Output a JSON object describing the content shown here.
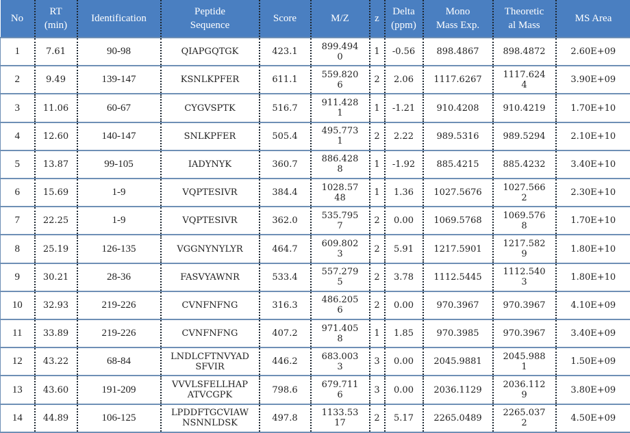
{
  "header_color": "#4a7fc1",
  "columns": [
    "No",
    "RT\n(min)",
    "Identification",
    "Peptide\nSequence",
    "Score",
    "M/Z",
    "z",
    "Delta\n(ppm)",
    "Mono\nMass Exp.",
    "Theoretic\nal Mass",
    "MS Area"
  ],
  "rows": [
    [
      "1",
      "7.61",
      "90-98",
      "QIAPGQTGK",
      "423.1",
      "899.494\n0",
      "1",
      "-0.56",
      "898.4867",
      "898.4872",
      "2.60E+09"
    ],
    [
      "2",
      "9.49",
      "139-147",
      "KSNLKPFER",
      "611.1",
      "559.820\n6",
      "2",
      "2.06",
      "1117.6267",
      "1117.624\n4",
      "3.90E+09"
    ],
    [
      "3",
      "11.06",
      "60-67",
      "CYGVSPTK",
      "516.7",
      "911.428\n1",
      "1",
      "-1.21",
      "910.4208",
      "910.4219",
      "1.70E+10"
    ],
    [
      "4",
      "12.60",
      "140-147",
      "SNLKPFER",
      "505.4",
      "495.773\n1",
      "2",
      "2.22",
      "989.5316",
      "989.5294",
      "2.10E+10"
    ],
    [
      "5",
      "13.87",
      "99-105",
      "IADYNYK",
      "360.7",
      "886.428\n8",
      "1",
      "-1.92",
      "885.4215",
      "885.4232",
      "3.40E+10"
    ],
    [
      "6",
      "15.69",
      "1-9",
      "VQPTESIVR",
      "384.4",
      "1028.57\n48",
      "1",
      "1.36",
      "1027.5676",
      "1027.566\n2",
      "2.30E+10"
    ],
    [
      "7",
      "22.25",
      "1-9",
      "VQPTESIVR",
      "362.0",
      "535.795\n7",
      "2",
      "0.00",
      "1069.5768",
      "1069.576\n8",
      "1.70E+10"
    ],
    [
      "8",
      "25.19",
      "126-135",
      "VGGNYNYLYR",
      "464.7",
      "609.802\n3",
      "2",
      "5.91",
      "1217.5901",
      "1217.582\n9",
      "1.80E+10"
    ],
    [
      "9",
      "30.21",
      "28-36",
      "FASVYAWNR",
      "533.4",
      "557.279\n5",
      "2",
      "3.78",
      "1112.5445",
      "1112.540\n3",
      "1.80E+10"
    ],
    [
      "10",
      "32.93",
      "219-226",
      "CVNFNFNG",
      "316.3",
      "486.205\n6",
      "2",
      "0.00",
      "970.3967",
      "970.3967",
      "4.10E+09"
    ],
    [
      "11",
      "33.89",
      "219-226",
      "CVNFNFNG",
      "407.2",
      "971.405\n8",
      "1",
      "1.85",
      "970.3985",
      "970.3967",
      "3.40E+09"
    ],
    [
      "12",
      "43.22",
      "68-84",
      "LNDLCFTNVYAD\nSFVIR",
      "446.2",
      "683.003\n3",
      "3",
      "0.00",
      "2045.9881",
      "2045.988\n1",
      "1.50E+09"
    ],
    [
      "13",
      "43.60",
      "191-209",
      "VVVLSFELLHAP\nATVCGPK",
      "798.6",
      "679.711\n6",
      "3",
      "0.00",
      "2036.1129",
      "2036.112\n9",
      "3.80E+09"
    ],
    [
      "14",
      "44.89",
      "106-125",
      "LPDDFTGCVIAW\nNSNNLDSK",
      "497.8",
      "1133.53\n17",
      "2",
      "5.17",
      "2265.0489",
      "2265.037\n2",
      "4.50E+09"
    ]
  ]
}
